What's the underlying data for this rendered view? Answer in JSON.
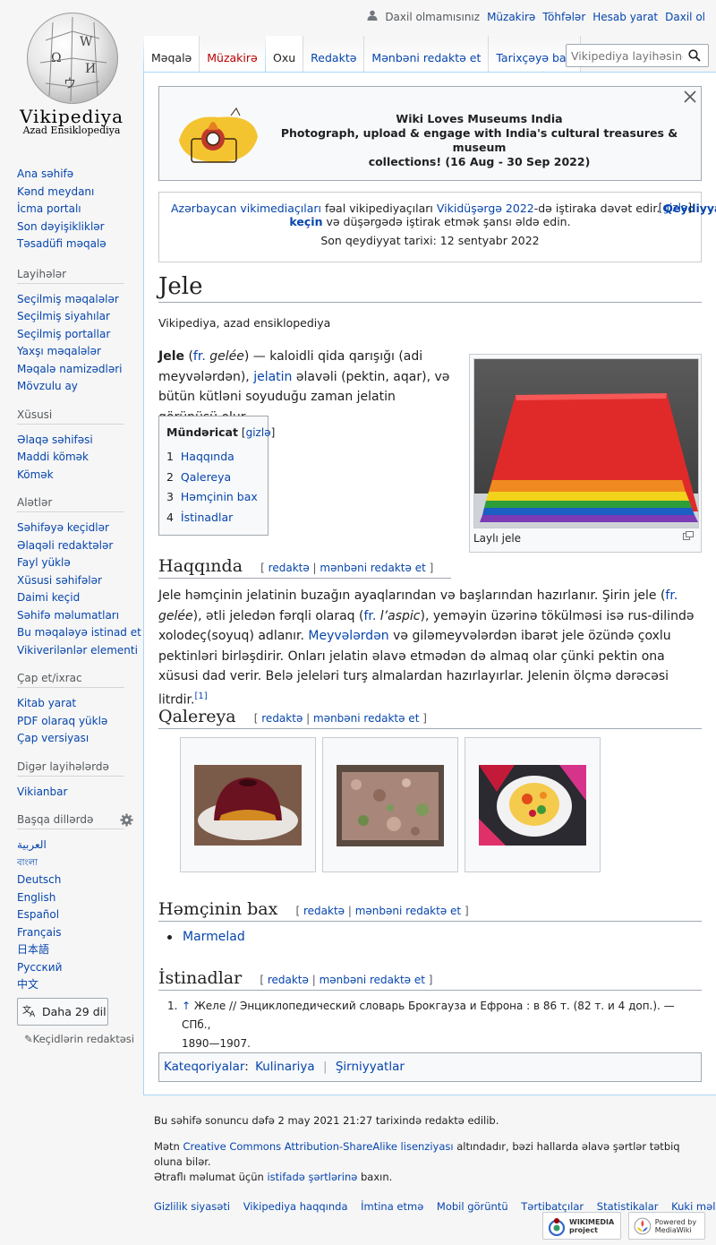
{
  "logo": {
    "wordmark": "Vikipediya",
    "tagline": "Azad Ensiklopediya",
    "glyphs": [
      "W",
      "Ω",
      "И",
      "ウ"
    ]
  },
  "personal": {
    "not_logged": "Daxil olmamısınız",
    "talk": "Müzakirə",
    "contrib": "Töhfələr",
    "create": "Hesab yarat",
    "login": "Daxil ol"
  },
  "tabs": {
    "article": "Məqalə",
    "talk": "Müzakirə",
    "read": "Oxu",
    "edit": "Redaktə",
    "edit_source": "Mənbəni redaktə et",
    "history": "Tarixçəyə bax"
  },
  "search": {
    "placeholder": "Vikipediya layihəsində axtar"
  },
  "sidebar": {
    "nav": [
      "Ana səhifə",
      "Kənd meydanı",
      "İcma portalı",
      "Son dəyişikliklər",
      "Təsadüfi məqalə"
    ],
    "sections": [
      {
        "title": "Layihələr",
        "items": [
          "Seçilmiş məqalələr",
          "Seçilmiş siyahılar",
          "Seçilmiş portallar",
          "Yaxşı məqalələr",
          "Məqalə namizədləri",
          "Mövzulu ay"
        ]
      },
      {
        "title": "Xüsusi",
        "items": [
          "Əlaqə səhifəsi",
          "Maddi kömək",
          "Kömək"
        ]
      },
      {
        "title": "Alətlər",
        "items": [
          "Səhifəyə keçidlər",
          "Əlaqəli redaktələr",
          "Fayl yüklə",
          "Xüsusi səhifələr",
          "Daimi keçid",
          "Səhifə məlumatları",
          "Bu məqaləyə istinad et",
          "Vikiverilənlər elementi"
        ]
      },
      {
        "title": "Çap et/ixrac",
        "items": [
          "Kitab yarat",
          "PDF olaraq yüklə",
          "Çap versiyası"
        ]
      },
      {
        "title": "Digər layihələrdə",
        "items": [
          "Vikianbar"
        ]
      }
    ],
    "languages": {
      "title": "Başqa dillərdə",
      "items": [
        "العربية",
        "বাংলা",
        "Deutsch",
        "English",
        "Español",
        "Français",
        "日本語",
        "Русский",
        "中文"
      ],
      "more": "Daha 29 dil",
      "edit_links": "Keçidlərin redaktəsi"
    }
  },
  "banner1": {
    "title": "Wiki Loves Museums India",
    "line1": "Photograph, upload & engage with India's cultural treasures & museum",
    "line2": "collections! (16 Aug - 30 Sep 2022)"
  },
  "banner2": {
    "link1": "Azərbaycan vikimediaçıları",
    "text1": " fəal vikipediyaçıları ",
    "link2": "Vikidüşərgə 2022",
    "text2": "-də iştiraka dəvət edir. ",
    "link3": "Qeydiyyatdan",
    "hide": "gizlə",
    "link4": "keçin",
    "text3": " və düşərgədə iştirak etmək şansı əldə edin.",
    "deadline": "Son qeydiyyat tarixi: 12 sentyabr 2022"
  },
  "article": {
    "title": "Jele",
    "tagline": "Vikipediya, azad ensiklopediya",
    "intro": {
      "b": "Jele",
      "p1": " (",
      "fr": "fr.",
      "gelee": " gelée",
      "p2": ") — kaloidli qida qarışığı (adi meyvələrdən), ",
      "jelatin": "jelatin",
      "p3": " əlavəli (pektin, aqar), və bütün kütləni soyuduğu zaman jelatin görünüşü olur."
    },
    "image_caption": "Laylı jele",
    "toc": {
      "title": "Mündəricat",
      "hide": "gizlə",
      "items": [
        [
          "1",
          "Haqqında"
        ],
        [
          "2",
          "Qalereya"
        ],
        [
          "3",
          "Həmçinin bax"
        ],
        [
          "4",
          "İstinadlar"
        ]
      ]
    },
    "edit": "redaktə",
    "edit_source": "mənbəni redaktə et",
    "s1": {
      "title": "Haqqında",
      "t1": "Jele həmçinin jelatinin buzağın ayaqlarından və başlarından hazırlanır. Şirin jele (",
      "fr1": "fr.",
      "gelee": " gelée",
      "t2": "), ətli jeledən fərqli olaraq (",
      "fr2": "fr.",
      "aspic": " l’aspic",
      "t3": "), yeməyin üzərinə tökülməsi isə rus-dilində xolodeç(soyuq) adlanır.",
      "link": "Meyvələrdən",
      "t4": " və giləmeyvələrdən ibarət jele özündə çoxlu pektinləri birləşdirir. Onları jelatin əlavə etmədən də almaq olar çünki pektin ona xüsusi dad verir. Belə jeleləri turş almalardan hazırlayırlar. Jelenin ölçmə dərəcəsi litrdir.",
      "ref": "[1]"
    },
    "s2": {
      "title": "Qalereya"
    },
    "s3": {
      "title": "Həmçinin bax",
      "items": [
        "Marmelad"
      ]
    },
    "s4": {
      "title": "İstinadlar",
      "ref_arrow": "↑",
      "ref_text1": " Желе // Энциклопедический словарь Брокгауза и Ефрона : в 86 т. (82 т. и 4 доп.). — СПб.,",
      "ref_text2": "1890—1907."
    },
    "categories": {
      "label": "Kateqoriyalar",
      "items": [
        "Kulinariya",
        "Şirniyyatlar"
      ]
    }
  },
  "footer": {
    "lastmod": "Bu səhifə sonuncu dəfə 2 may 2021 21:27 tarixində redaktə edilib.",
    "license_pre": "Mətn ",
    "license_link": "Creative Commons Attribution-ShareAlike lisenziyası",
    "license_post": " altındadır, bəzi hallarda əlavə şərtlər tətbiq oluna bilər.",
    "terms_pre": "Ətraflı məlumat üçün ",
    "terms_link": "istifadə şərtlərinə",
    "terms_post": " baxın.",
    "links": [
      "Gizlilik siyasəti",
      "Vikipediya haqqında",
      "İmtina etmə",
      "Mobil görüntü",
      "Tərtibatçılar",
      "Statistikalar",
      "Kuki məlumatı"
    ],
    "wikimedia_badge": "WIKIMEDIA project",
    "mediawiki_badge": "Powered by MediaWiki"
  }
}
